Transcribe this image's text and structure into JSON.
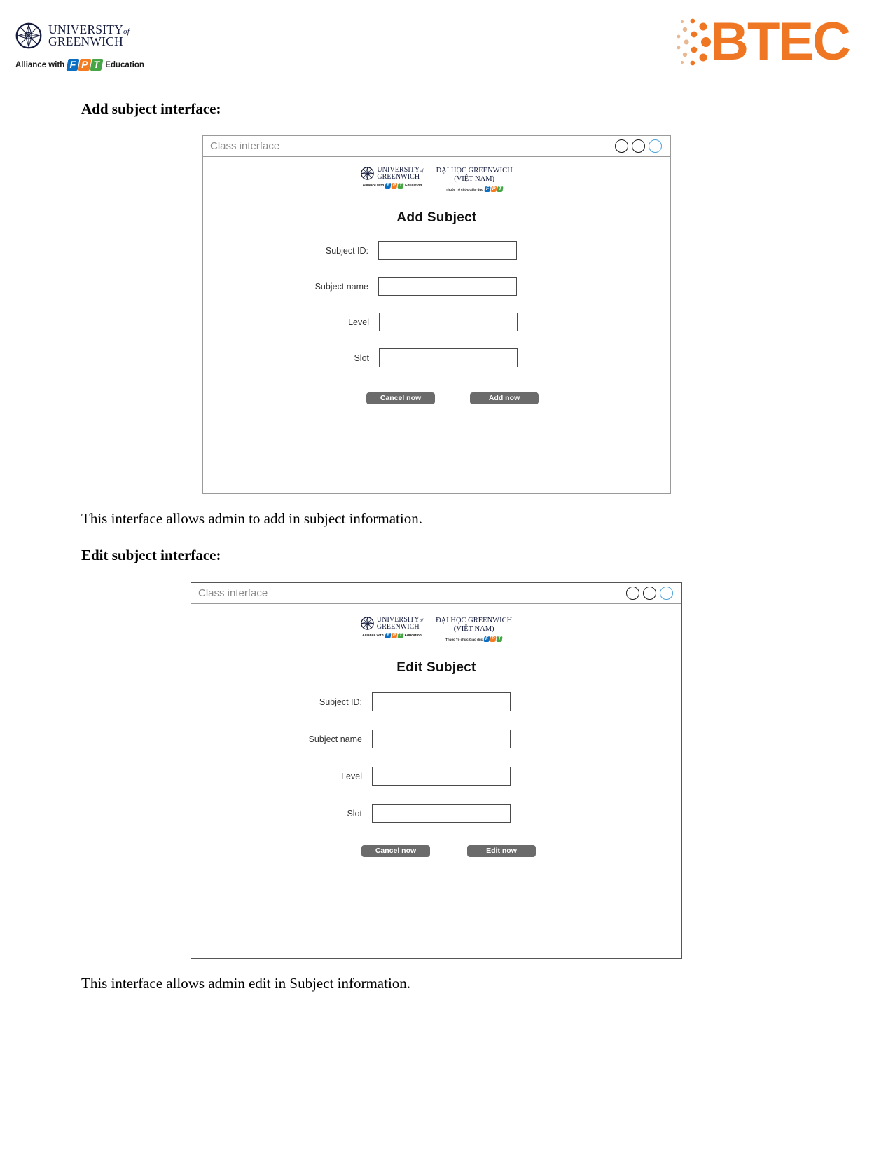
{
  "header": {
    "university": {
      "line1": "UNIVERSITY",
      "of": "of",
      "line2": "GREENWICH",
      "alliance_pre": "Alliance with",
      "fpt_f": "F",
      "fpt_p": "P",
      "fpt_t": "T",
      "alliance_post": "Education"
    },
    "btec": {
      "wordmark": "BTEC",
      "color": "#ef7622"
    }
  },
  "sections": [
    {
      "heading": "Add subject interface:",
      "caption": "This interface allows admin to add in subject information.",
      "window": {
        "title": "Class interface",
        "window_buttons": [
          "minimize-circle",
          "maximize-circle",
          "close-circle"
        ],
        "logos": {
          "uog_line1": "UNIVERSITY",
          "uog_of": "of",
          "uog_line2": "GREENWICH",
          "uog_alliance_pre": "Alliance with",
          "uog_alliance_post": "Education",
          "vn_line1": "ĐẠI HỌC GREENWICH",
          "vn_line2": "(VIỆT NAM)",
          "vn_sub_pre": "Thuộc Tổ chức Giáo dục"
        },
        "form_title": "Add Subject",
        "fields": [
          {
            "label": "Subject ID:",
            "value": "",
            "placeholder": ""
          },
          {
            "label": "Subject name",
            "value": "",
            "placeholder": ""
          },
          {
            "label": "Level",
            "value": "",
            "placeholder": ""
          },
          {
            "label": "Slot",
            "value": "",
            "placeholder": ""
          }
        ],
        "buttons": {
          "cancel": "Cancel now",
          "primary": "Add now"
        }
      }
    },
    {
      "heading": "Edit subject interface:",
      "caption": "This interface allows admin edit in Subject information.",
      "window": {
        "title": "Class interface",
        "window_buttons": [
          "minimize-circle",
          "maximize-circle",
          "close-circle"
        ],
        "logos": {
          "uog_line1": "UNIVERSITY",
          "uog_of": "of",
          "uog_line2": "GREENWICH",
          "uog_alliance_pre": "Alliance with",
          "uog_alliance_post": "Education",
          "vn_line1": "ĐẠI HỌC GREENWICH",
          "vn_line2": "(VIỆT NAM)",
          "vn_sub_pre": "Thuộc Tổ chức Giáo dục"
        },
        "form_title": "Edit Subject",
        "fields": [
          {
            "label": "Subject ID:",
            "value": "",
            "placeholder": ""
          },
          {
            "label": "Subject name",
            "value": "",
            "placeholder": ""
          },
          {
            "label": "Level",
            "value": "",
            "placeholder": ""
          },
          {
            "label": "Slot",
            "value": "",
            "placeholder": ""
          }
        ],
        "buttons": {
          "cancel": "Cancel now",
          "primary": "Edit now"
        }
      }
    }
  ]
}
